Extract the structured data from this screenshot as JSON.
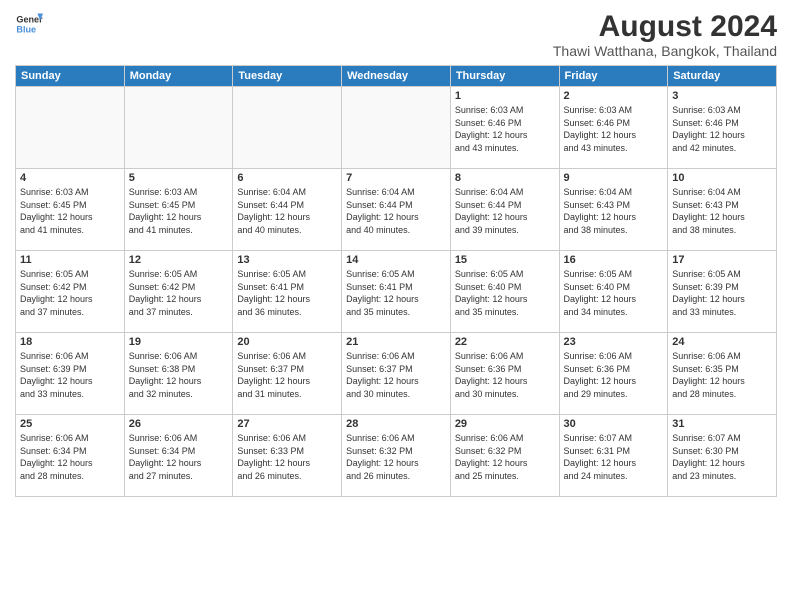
{
  "header": {
    "logo_line1": "General",
    "logo_line2": "Blue",
    "main_title": "August 2024",
    "subtitle": "Thawi Watthana, Bangkok, Thailand"
  },
  "days_of_week": [
    "Sunday",
    "Monday",
    "Tuesday",
    "Wednesday",
    "Thursday",
    "Friday",
    "Saturday"
  ],
  "weeks": [
    [
      {
        "day": "",
        "info": ""
      },
      {
        "day": "",
        "info": ""
      },
      {
        "day": "",
        "info": ""
      },
      {
        "day": "",
        "info": ""
      },
      {
        "day": "1",
        "info": "Sunrise: 6:03 AM\nSunset: 6:46 PM\nDaylight: 12 hours\nand 43 minutes."
      },
      {
        "day": "2",
        "info": "Sunrise: 6:03 AM\nSunset: 6:46 PM\nDaylight: 12 hours\nand 43 minutes."
      },
      {
        "day": "3",
        "info": "Sunrise: 6:03 AM\nSunset: 6:46 PM\nDaylight: 12 hours\nand 42 minutes."
      }
    ],
    [
      {
        "day": "4",
        "info": "Sunrise: 6:03 AM\nSunset: 6:45 PM\nDaylight: 12 hours\nand 41 minutes."
      },
      {
        "day": "5",
        "info": "Sunrise: 6:03 AM\nSunset: 6:45 PM\nDaylight: 12 hours\nand 41 minutes."
      },
      {
        "day": "6",
        "info": "Sunrise: 6:04 AM\nSunset: 6:44 PM\nDaylight: 12 hours\nand 40 minutes."
      },
      {
        "day": "7",
        "info": "Sunrise: 6:04 AM\nSunset: 6:44 PM\nDaylight: 12 hours\nand 40 minutes."
      },
      {
        "day": "8",
        "info": "Sunrise: 6:04 AM\nSunset: 6:44 PM\nDaylight: 12 hours\nand 39 minutes."
      },
      {
        "day": "9",
        "info": "Sunrise: 6:04 AM\nSunset: 6:43 PM\nDaylight: 12 hours\nand 38 minutes."
      },
      {
        "day": "10",
        "info": "Sunrise: 6:04 AM\nSunset: 6:43 PM\nDaylight: 12 hours\nand 38 minutes."
      }
    ],
    [
      {
        "day": "11",
        "info": "Sunrise: 6:05 AM\nSunset: 6:42 PM\nDaylight: 12 hours\nand 37 minutes."
      },
      {
        "day": "12",
        "info": "Sunrise: 6:05 AM\nSunset: 6:42 PM\nDaylight: 12 hours\nand 37 minutes."
      },
      {
        "day": "13",
        "info": "Sunrise: 6:05 AM\nSunset: 6:41 PM\nDaylight: 12 hours\nand 36 minutes."
      },
      {
        "day": "14",
        "info": "Sunrise: 6:05 AM\nSunset: 6:41 PM\nDaylight: 12 hours\nand 35 minutes."
      },
      {
        "day": "15",
        "info": "Sunrise: 6:05 AM\nSunset: 6:40 PM\nDaylight: 12 hours\nand 35 minutes."
      },
      {
        "day": "16",
        "info": "Sunrise: 6:05 AM\nSunset: 6:40 PM\nDaylight: 12 hours\nand 34 minutes."
      },
      {
        "day": "17",
        "info": "Sunrise: 6:05 AM\nSunset: 6:39 PM\nDaylight: 12 hours\nand 33 minutes."
      }
    ],
    [
      {
        "day": "18",
        "info": "Sunrise: 6:06 AM\nSunset: 6:39 PM\nDaylight: 12 hours\nand 33 minutes."
      },
      {
        "day": "19",
        "info": "Sunrise: 6:06 AM\nSunset: 6:38 PM\nDaylight: 12 hours\nand 32 minutes."
      },
      {
        "day": "20",
        "info": "Sunrise: 6:06 AM\nSunset: 6:37 PM\nDaylight: 12 hours\nand 31 minutes."
      },
      {
        "day": "21",
        "info": "Sunrise: 6:06 AM\nSunset: 6:37 PM\nDaylight: 12 hours\nand 30 minutes."
      },
      {
        "day": "22",
        "info": "Sunrise: 6:06 AM\nSunset: 6:36 PM\nDaylight: 12 hours\nand 30 minutes."
      },
      {
        "day": "23",
        "info": "Sunrise: 6:06 AM\nSunset: 6:36 PM\nDaylight: 12 hours\nand 29 minutes."
      },
      {
        "day": "24",
        "info": "Sunrise: 6:06 AM\nSunset: 6:35 PM\nDaylight: 12 hours\nand 28 minutes."
      }
    ],
    [
      {
        "day": "25",
        "info": "Sunrise: 6:06 AM\nSunset: 6:34 PM\nDaylight: 12 hours\nand 28 minutes."
      },
      {
        "day": "26",
        "info": "Sunrise: 6:06 AM\nSunset: 6:34 PM\nDaylight: 12 hours\nand 27 minutes."
      },
      {
        "day": "27",
        "info": "Sunrise: 6:06 AM\nSunset: 6:33 PM\nDaylight: 12 hours\nand 26 minutes."
      },
      {
        "day": "28",
        "info": "Sunrise: 6:06 AM\nSunset: 6:32 PM\nDaylight: 12 hours\nand 26 minutes."
      },
      {
        "day": "29",
        "info": "Sunrise: 6:06 AM\nSunset: 6:32 PM\nDaylight: 12 hours\nand 25 minutes."
      },
      {
        "day": "30",
        "info": "Sunrise: 6:07 AM\nSunset: 6:31 PM\nDaylight: 12 hours\nand 24 minutes."
      },
      {
        "day": "31",
        "info": "Sunrise: 6:07 AM\nSunset: 6:30 PM\nDaylight: 12 hours\nand 23 minutes."
      }
    ]
  ]
}
